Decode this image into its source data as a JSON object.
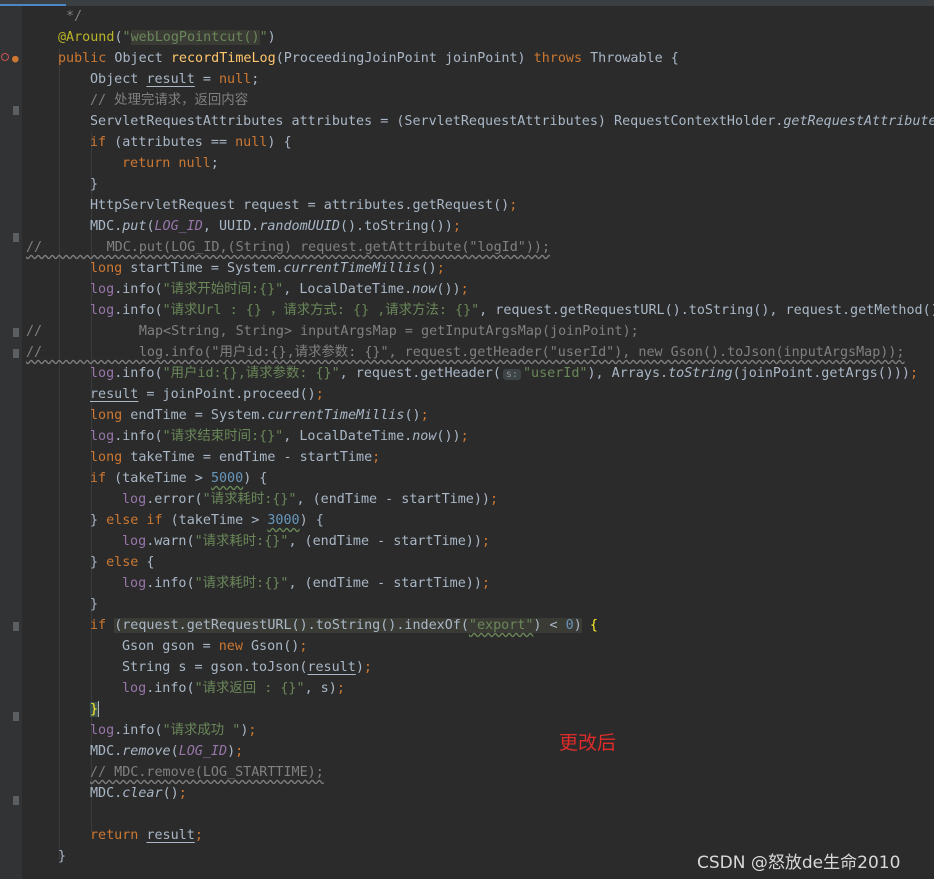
{
  "editor": {
    "lines": [
      "*/",
      "@Around(\"webLogPointcut()\")",
      "public Object recordTimeLog(ProceedingJoinPoint joinPoint) throws Throwable {",
      "Object result = null;",
      "// 处理完请求，返回内容",
      "ServletRequestAttributes attributes = (ServletRequestAttributes) RequestContextHolder.getRequestAttributes",
      "if (attributes == null) {",
      "return null;",
      "}",
      "HttpServletRequest request = attributes.getRequest();",
      "MDC.put(LOG_ID, UUID.randomUUID().toString());",
      "//        MDC.put(LOG_ID,(String) request.getAttribute(\"logId\"));",
      "long startTime = System.currentTimeMillis();",
      "log.info(\"请求开始时间:{}\", LocalDateTime.now());",
      "log.info(\"请求Url : {} ，请求方式: {} ,请求方法: {}\", request.getRequestURL().toString(), request.getMethod(),",
      "//            Map<String, String> inputArgsMap = getInputArgsMap(joinPoint);",
      "//            log.info(\"用户id:{},请求参数: {}\", request.getHeader(\"userId\"), new Gson().toJson(inputArgsMap));",
      "log.info(\"用户id:{},请求参数: {}\", request.getHeader( s: \"userId\"), Arrays.toString(joinPoint.getArgs()));",
      "result = joinPoint.proceed();",
      "long endTime = System.currentTimeMillis();",
      "log.info(\"请求结束时间:{}\", LocalDateTime.now());",
      "long takeTime = endTime - startTime;",
      "if (takeTime > 5000) {",
      "log.error(\"请求耗时:{}\", (endTime - startTime));",
      "} else if (takeTime > 3000) {",
      "log.warn(\"请求耗时:{}\", (endTime - startTime));",
      "} else {",
      "log.info(\"请求耗时:{}\", (endTime - startTime));",
      "}",
      "if (request.getRequestURL().toString().indexOf(\"export\") < 0) {",
      "Gson gson = new Gson();",
      "String s = gson.toJson(result);",
      "log.info(\"请求返回 : {}\", s);",
      "}",
      "log.info(\"请求成功 \");",
      "MDC.remove(LOG_ID);",
      "// MDC.remove(LOG_STARTTIME);",
      "MDC.clear();",
      "",
      "return result;",
      "}"
    ]
  },
  "annotation_text": "更改后",
  "watermark": "CSDN @怒放de生命2010",
  "colors": {
    "background": "#2b2b2b",
    "keyword": "#cc7832",
    "string": "#6a8759",
    "number": "#6897bb",
    "comment": "#808080",
    "method": "#ffc66d",
    "annotation": "#bbb529",
    "annotation_text": "#e02b2b"
  }
}
